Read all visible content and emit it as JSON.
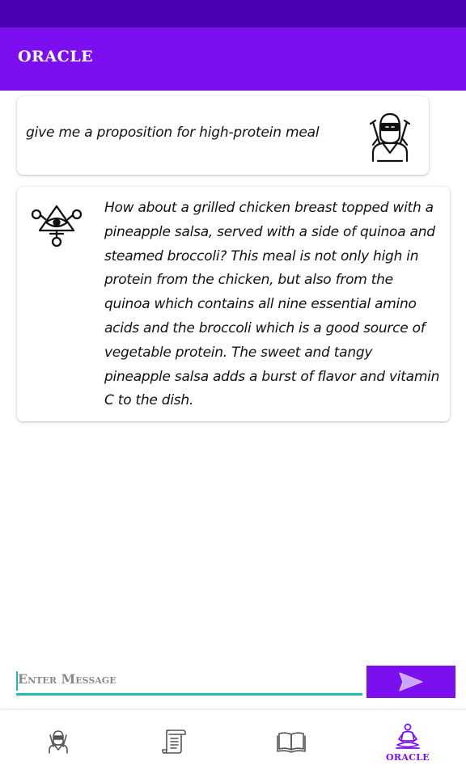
{
  "app": {
    "title": "ORACLE",
    "accent_color": "#7c0ff0",
    "status_bar_color": "#4a00b0",
    "input_underline_color": "#1fbfb0"
  },
  "messages": [
    {
      "sender": "user",
      "avatar_icon": "ninja-avatar-icon",
      "text": "give me a proposition for high-protein meal"
    },
    {
      "sender": "oracle",
      "avatar_icon": "all-seeing-eye-triangle-icon",
      "text": "How about a grilled chicken breast topped with a pineapple salsa, served with a side of quinoa and steamed broccoli? This meal is not only high in protein from the chicken, but also from the quinoa which contains all nine essential amino acids and the broccoli which is a good source of vegetable protein. The sweet and tangy pineapple salsa adds a burst of flavor and vitamin C to the dish."
    }
  ],
  "composer": {
    "placeholder": "Enter Message",
    "value": "",
    "send_icon": "send-arrow-icon"
  },
  "bottom_nav": {
    "items": [
      {
        "icon": "ninja-icon",
        "label": "",
        "active": false
      },
      {
        "icon": "scroll-icon",
        "label": "",
        "active": false
      },
      {
        "icon": "open-book-icon",
        "label": "",
        "active": false
      },
      {
        "icon": "meditating-oracle-icon",
        "label": "ORACLE",
        "active": true
      }
    ]
  }
}
